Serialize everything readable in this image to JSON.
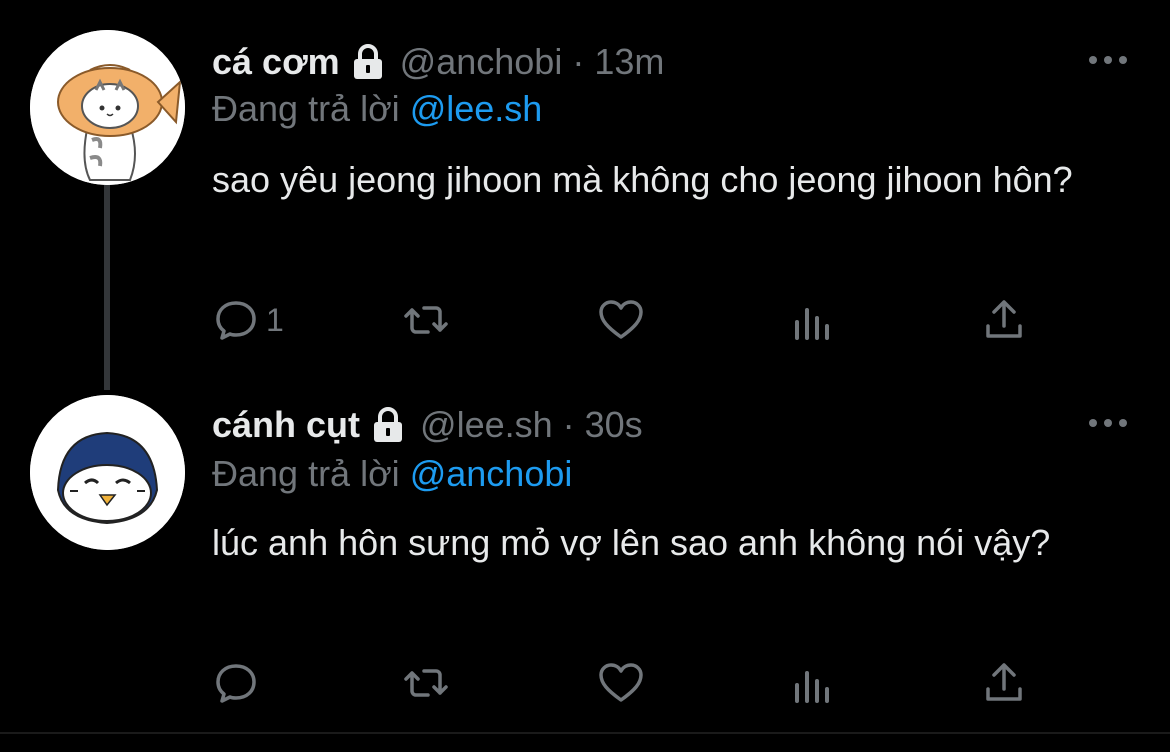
{
  "tweets": [
    {
      "name": "cá cơm",
      "handle": "@anchobi",
      "separator": "·",
      "time": "13m",
      "replying_prefix": "Đang trả lời",
      "replying_to": "@lee.sh",
      "text": "sao yêu jeong jihoon mà không cho jeong jihoon hôn?",
      "reply_count": "1",
      "avatar_icon": "fish-cat-avatar"
    },
    {
      "name": "cánh cụt",
      "handle": "@lee.sh",
      "separator": "·",
      "time": "30s",
      "replying_prefix": "Đang trả lời",
      "replying_to": "@anchobi",
      "text": "lúc anh hôn sưng mỏ vợ lên sao anh không nói vậy?",
      "reply_count": "",
      "avatar_icon": "penguin-avatar"
    }
  ],
  "icons": [
    "lock-icon",
    "more-icon",
    "reply-icon",
    "retweet-icon",
    "like-icon",
    "analytics-icon",
    "share-icon"
  ],
  "colors": {
    "background": "#000000",
    "text": "#e7e9ea",
    "muted": "#71767b",
    "link": "#1d9bf0"
  }
}
